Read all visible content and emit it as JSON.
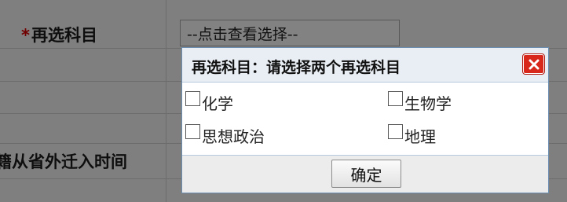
{
  "form": {
    "elective_label": "再选科目",
    "required_marker": "*",
    "elective_select_value": "--点击查看选择--",
    "migration_label": "籍从省外迁入时间"
  },
  "dialog": {
    "title": "再选科目：请选择两个再选科目",
    "options": [
      {
        "label": "化学",
        "checked": false
      },
      {
        "label": "生物学",
        "checked": false
      },
      {
        "label": "思想政治",
        "checked": false
      },
      {
        "label": "地理",
        "checked": false
      }
    ],
    "confirm_label": "确定",
    "close_icon": "close-icon",
    "close_color": "#d8281c"
  }
}
